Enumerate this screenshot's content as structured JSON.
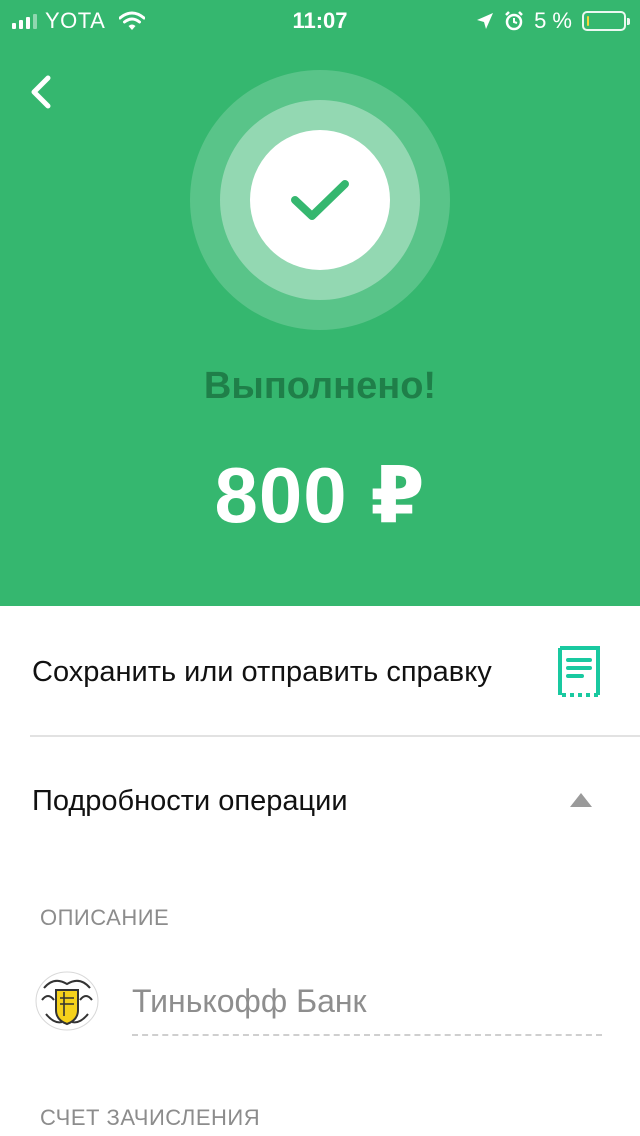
{
  "status_bar": {
    "carrier": "YOTA",
    "time": "11:07",
    "battery_percent": "5 %",
    "battery_level": 0.05
  },
  "colors": {
    "accent": "#35b76f",
    "done_text": "#1f7f49",
    "receipt_icon": "#19c9a0",
    "secondary_text": "#8c8c8c"
  },
  "header": {
    "status_text": "Выполнено!",
    "amount": "800 ₽"
  },
  "actions": {
    "save_receipt_label": "Сохранить или отправить справку",
    "details_label": "Подробности операции"
  },
  "details": {
    "description_title": "ОПИСАНИЕ",
    "description_value": "Тинькофф Банк",
    "account_title": "СЧЕТ ЗАЧИСЛЕНИЯ"
  },
  "icons": {
    "back": "chevron-left-icon",
    "success": "checkmark-icon",
    "receipt": "receipt-icon",
    "expand": "triangle-up-icon",
    "bank": "tinkoff-logo"
  }
}
